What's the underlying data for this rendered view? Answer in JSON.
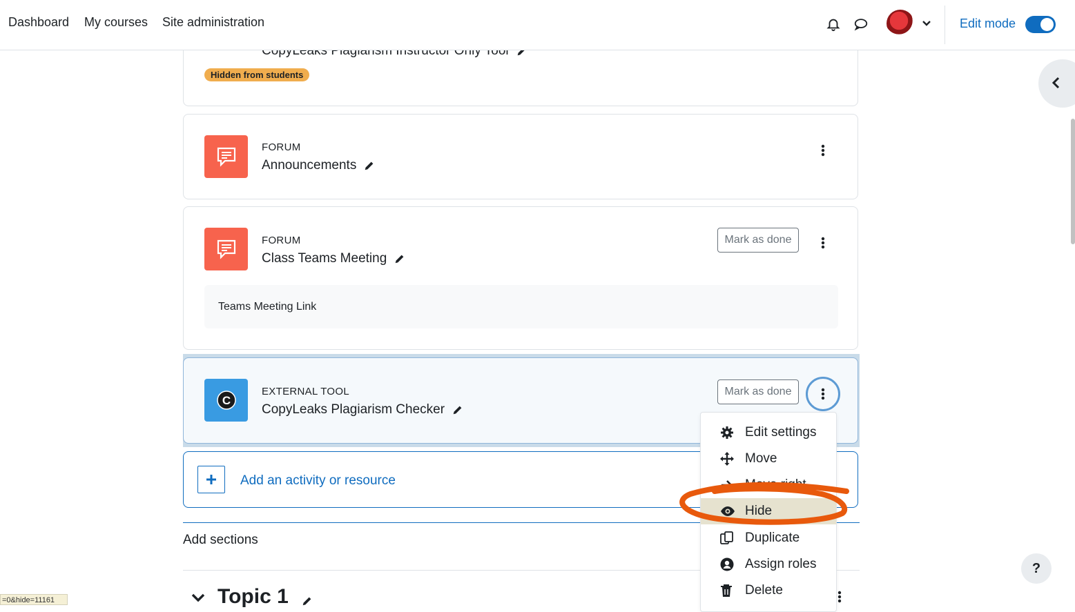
{
  "nav": {
    "links": [
      "Dashboard",
      "My courses",
      "Site administration"
    ],
    "edit_mode_label": "Edit mode",
    "edit_mode_on": true
  },
  "cards": {
    "top": {
      "name": "CopyLeaks Plagiarism Instructor Only Tool",
      "badge": "Hidden from students"
    },
    "announcements": {
      "type": "FORUM",
      "name": "Announcements"
    },
    "teams": {
      "type": "FORUM",
      "name": "Class Teams Meeting",
      "mark_done": "Mark as done",
      "description": "Teams Meeting Link"
    },
    "copyleaks": {
      "type": "EXTERNAL TOOL",
      "name": "CopyLeaks Plagiarism Checker",
      "mark_done": "Mark as done"
    }
  },
  "add_activity": "Add an activity or resource",
  "add_sections": "Add sections",
  "topic": {
    "title": "Topic 1"
  },
  "menu": {
    "items": [
      {
        "label": "Edit settings",
        "icon": "gear-icon"
      },
      {
        "label": "Move",
        "icon": "move-arrows-icon"
      },
      {
        "label": "Move right",
        "icon": "arrow-right-icon"
      },
      {
        "label": "Hide",
        "icon": "eye-icon",
        "highlighted": true
      },
      {
        "label": "Duplicate",
        "icon": "duplicate-icon"
      },
      {
        "label": "Assign roles",
        "icon": "user-circle-icon"
      },
      {
        "label": "Delete",
        "icon": "trash-icon"
      }
    ]
  },
  "help_label": "?",
  "status_url": "=0&hide=11161",
  "colors": {
    "brand": "#0f6cbf",
    "forum_icon": "#f7634d",
    "lti_icon": "#399be2",
    "badge": "#f0ad4e",
    "annotation": "#e8590c"
  }
}
